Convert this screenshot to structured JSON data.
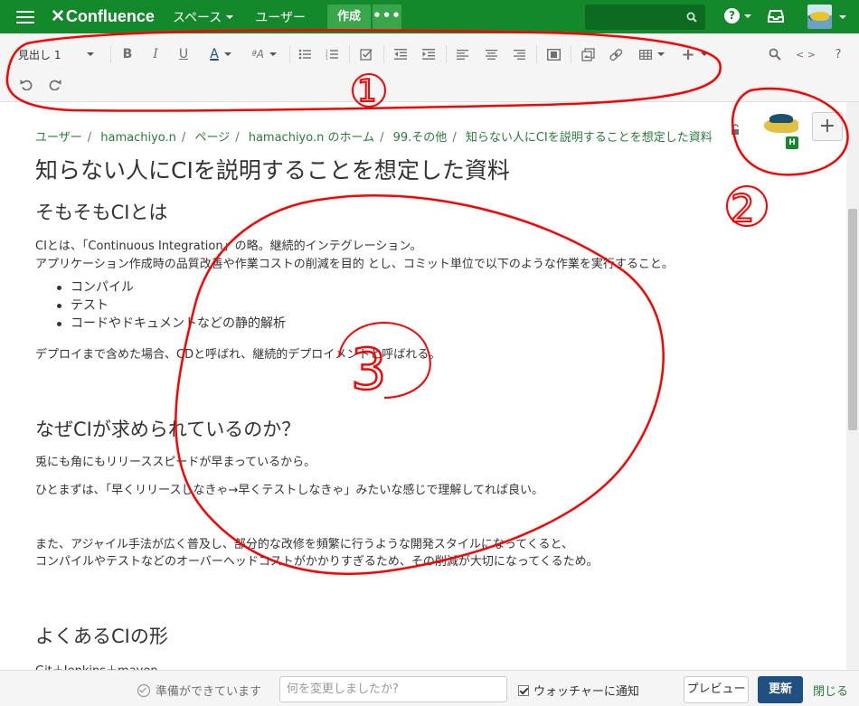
{
  "nav": {
    "logo": "Confluence",
    "spaces": "スペース",
    "users": "ユーザー",
    "create": "作成",
    "more": "•••"
  },
  "toolbar": {
    "heading_select": "見出し 1"
  },
  "breadcrumbs": [
    "ユーザー",
    "hamachiyo.n",
    "ページ",
    "hamachiyo.n のホーム",
    "99.その他",
    "知らない人にCIを説明することを想定した資料"
  ],
  "page": {
    "title": "知らない人にCIを説明することを想定した資料",
    "sections": [
      {
        "heading": "そもそもCIとは",
        "lines": [
          "CIとは、「Continuous Integration」の略。継続的インテグレーション。",
          "アプリケーション作成時の品質改善や作業コストの削減を目的 とし、コミット単位で以下のような作業を実行すること。"
        ],
        "bullets": [
          "コンパイル",
          "テスト",
          "コードやドキュメントなどの静的解析"
        ],
        "after": "デプロイまで含めた場合、CDと呼ばれ、継続的デプロイメントと呼ばれる。"
      },
      {
        "heading": "なぜCIが求められているのか？",
        "p1": "兎にも角にもリリーススピードが早まっているから。",
        "p2": "ひとまずは、「早くリリースしなきゃ→早くテストしなきゃ」みたいな感じで理解してれば良い。",
        "p3a": "また、アジャイル手法が広く普及し、部分的な改修を頻繁に行うような開発スタイルになってくると、",
        "p3b": "コンパイルやテストなどのオーバーヘッドコストがかかりすぎるため、その削減が大切になってくるため。"
      },
      {
        "heading": "よくあるCIの形",
        "p1": "Git＋Jenkins＋maven"
      }
    ],
    "avatar_badge": "H"
  },
  "bottom": {
    "status": "準備ができています",
    "comment_placeholder": "何を変更しましたか?",
    "watch_label": "ウォッチャーに通知",
    "preview": "プレビュー",
    "update": "更新",
    "close": "閉じる"
  },
  "annotations": {
    "color": "#ff0000",
    "labels": [
      "1",
      "2",
      "3"
    ]
  },
  "colors": {
    "nav_bg": "#14892c",
    "link": "#2a7c39",
    "update_btn": "#205081"
  }
}
